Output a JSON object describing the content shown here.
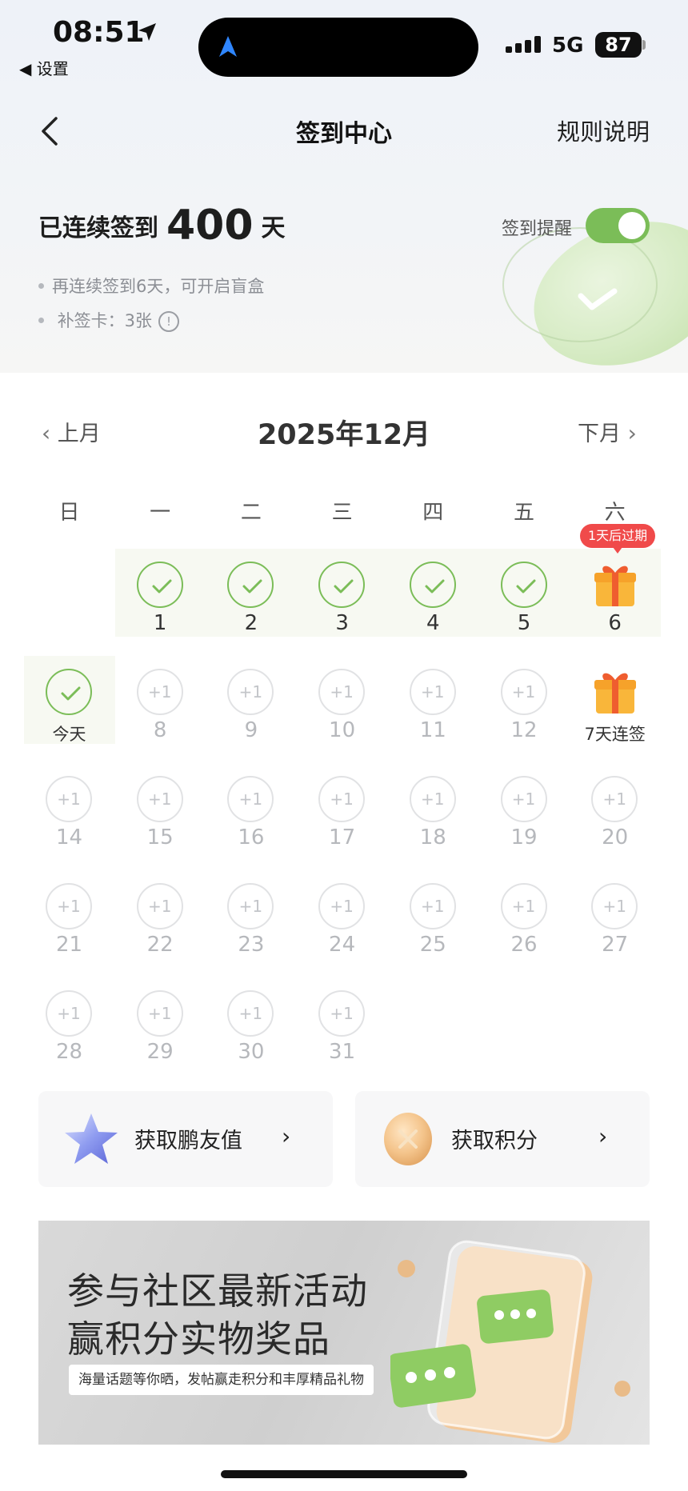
{
  "status_bar": {
    "time": "08:51",
    "back_app": "◀ 设置",
    "network": "5G",
    "battery": "87"
  },
  "header": {
    "title": "签到中心",
    "rules_link": "规则说明"
  },
  "summary": {
    "streak_prefix": "已连续签到",
    "streak_days": "400",
    "streak_suffix": "天",
    "bullet_1": "再连续签到6天，可开启盲盒",
    "bullet_2": "补签卡：3张",
    "reminder_label": "签到提醒",
    "reminder_on": true
  },
  "calendar": {
    "prev_label": "上月",
    "next_label": "下月",
    "month_title": "2025年12月",
    "weekdays": [
      "日",
      "一",
      "二",
      "三",
      "四",
      "五",
      "六"
    ],
    "expire_badge": "1天后过期",
    "plus_label": "+1",
    "today_label": "今天",
    "streak_reward_label": "7天连签",
    "days": [
      {
        "day": "1",
        "state": "done"
      },
      {
        "day": "2",
        "state": "done"
      },
      {
        "day": "3",
        "state": "done"
      },
      {
        "day": "4",
        "state": "done"
      },
      {
        "day": "5",
        "state": "done"
      },
      {
        "day": "6",
        "state": "gift"
      },
      {
        "day": "今天",
        "state": "today"
      },
      {
        "day": "8",
        "state": "future"
      },
      {
        "day": "9",
        "state": "future"
      },
      {
        "day": "10",
        "state": "future"
      },
      {
        "day": "11",
        "state": "future"
      },
      {
        "day": "12",
        "state": "future"
      },
      {
        "day": "7天连签",
        "state": "reward"
      },
      {
        "day": "14",
        "state": "future"
      },
      {
        "day": "15",
        "state": "future"
      },
      {
        "day": "16",
        "state": "future"
      },
      {
        "day": "17",
        "state": "future"
      },
      {
        "day": "18",
        "state": "future"
      },
      {
        "day": "19",
        "state": "future"
      },
      {
        "day": "20",
        "state": "future"
      },
      {
        "day": "21",
        "state": "future"
      },
      {
        "day": "22",
        "state": "future"
      },
      {
        "day": "23",
        "state": "future"
      },
      {
        "day": "24",
        "state": "future"
      },
      {
        "day": "25",
        "state": "future"
      },
      {
        "day": "26",
        "state": "future"
      },
      {
        "day": "27",
        "state": "future"
      },
      {
        "day": "28",
        "state": "future"
      },
      {
        "day": "29",
        "state": "future"
      },
      {
        "day": "30",
        "state": "future"
      },
      {
        "day": "31",
        "state": "future"
      }
    ]
  },
  "cards": {
    "friend_value": "获取鹏友值",
    "points": "获取积分"
  },
  "banner": {
    "line1": "参与社区最新活动",
    "line2": "赢积分实物奖品",
    "subtitle": "海量话题等你晒，发帖赢走积分和丰厚精品礼物"
  },
  "colors": {
    "accent_green": "#7bbd58",
    "badge_red": "#f04a4a"
  }
}
